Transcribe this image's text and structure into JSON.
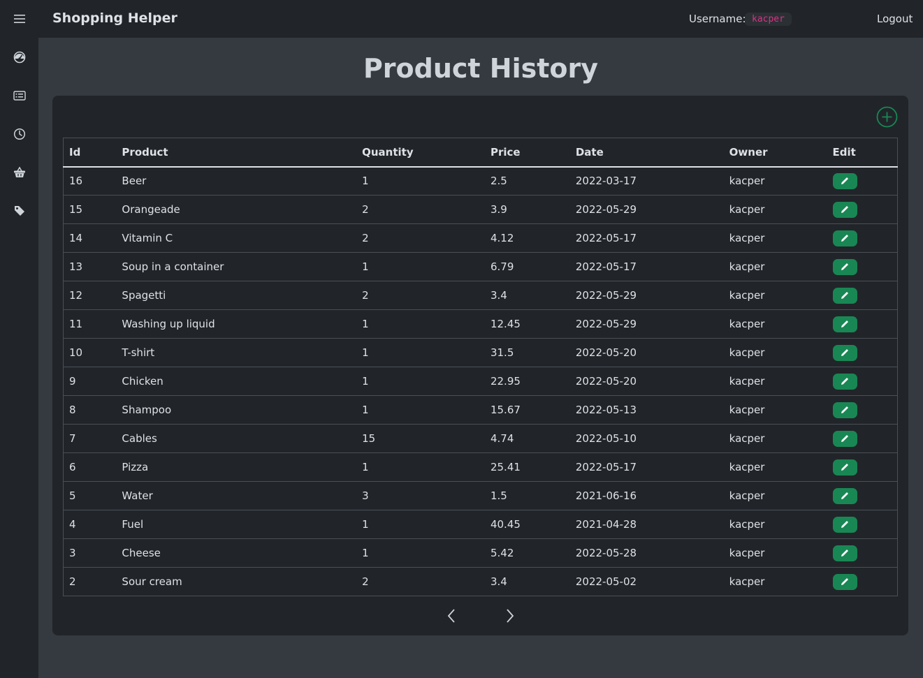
{
  "app": {
    "title": "Shopping Helper"
  },
  "header": {
    "username_label": "Username:",
    "username": "kacper",
    "logout_label": "Logout"
  },
  "sidebar": {
    "items": [
      {
        "icon": "menu-icon"
      },
      {
        "icon": "dashboard-icon"
      },
      {
        "icon": "list-icon"
      },
      {
        "icon": "history-icon"
      },
      {
        "icon": "basket-icon"
      },
      {
        "icon": "tag-icon"
      }
    ]
  },
  "page": {
    "title": "Product History"
  },
  "table": {
    "columns": [
      "Id",
      "Product",
      "Quantity",
      "Price",
      "Date",
      "Owner",
      "Edit"
    ],
    "rows": [
      [
        "16",
        "Beer",
        "1",
        "2.5",
        "2022-03-17",
        "kacper"
      ],
      [
        "15",
        "Orangeade",
        "2",
        "3.9",
        "2022-05-29",
        "kacper"
      ],
      [
        "14",
        "Vitamin C",
        "2",
        "4.12",
        "2022-05-17",
        "kacper"
      ],
      [
        "13",
        "Soup in a container",
        "1",
        "6.79",
        "2022-05-17",
        "kacper"
      ],
      [
        "12",
        "Spagetti",
        "2",
        "3.4",
        "2022-05-29",
        "kacper"
      ],
      [
        "11",
        "Washing up liquid",
        "1",
        "12.45",
        "2022-05-29",
        "kacper"
      ],
      [
        "10",
        "T-shirt",
        "1",
        "31.5",
        "2022-05-20",
        "kacper"
      ],
      [
        "9",
        "Chicken",
        "1",
        "22.95",
        "2022-05-20",
        "kacper"
      ],
      [
        "8",
        "Shampoo",
        "1",
        "15.67",
        "2022-05-13",
        "kacper"
      ],
      [
        "7",
        "Cables",
        "15",
        "4.74",
        "2022-05-10",
        "kacper"
      ],
      [
        "6",
        "Pizza",
        "1",
        "25.41",
        "2022-05-17",
        "kacper"
      ],
      [
        "5",
        "Water",
        "3",
        "1.5",
        "2021-06-16",
        "kacper"
      ],
      [
        "4",
        "Fuel",
        "1",
        "40.45",
        "2021-04-28",
        "kacper"
      ],
      [
        "3",
        "Cheese",
        "1",
        "5.42",
        "2022-05-28",
        "kacper"
      ],
      [
        "2",
        "Sour cream",
        "2",
        "3.4",
        "2022-05-02",
        "kacper"
      ]
    ]
  },
  "colors": {
    "accent_green": "#198754",
    "username_pink": "#d63384",
    "background": "#343a40",
    "panel": "#212529"
  }
}
